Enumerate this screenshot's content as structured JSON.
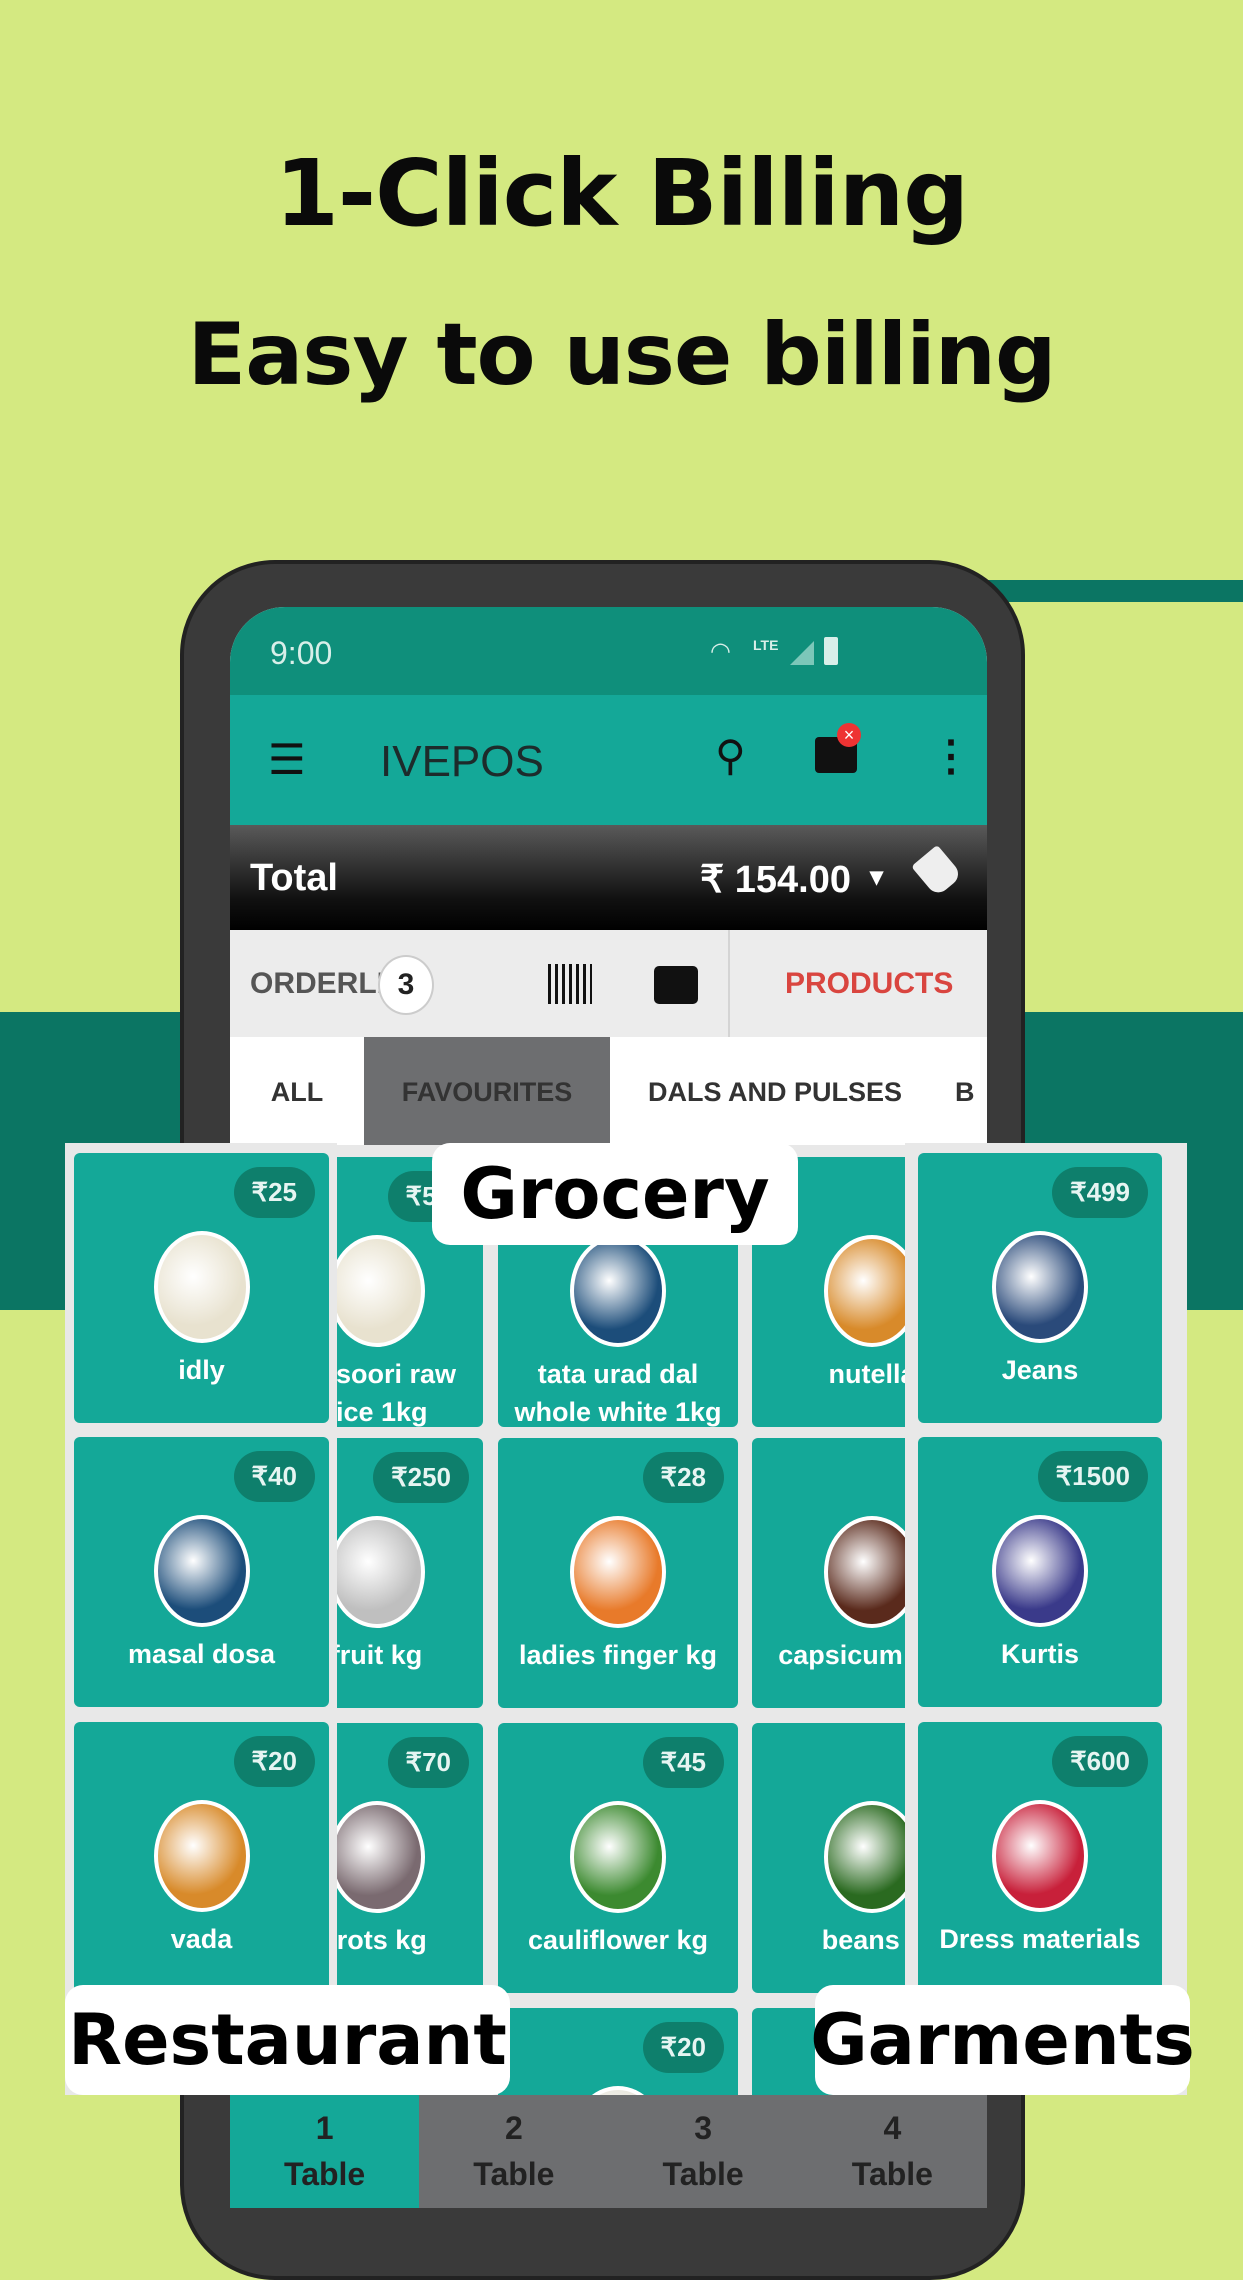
{
  "headline": "1-Click Billing",
  "subheadline": "Easy to use billing",
  "status": {
    "time": "9:00",
    "network": "LTE"
  },
  "appbar": {
    "title": "IVEPOS"
  },
  "total": {
    "label": "Total",
    "amount": "₹ 154.00"
  },
  "orderbar": {
    "orderlist": "ORDERLIST",
    "count": "3",
    "products": "PRODUCTS"
  },
  "categories": [
    {
      "label": "ALL"
    },
    {
      "label": "FAVOURITES"
    },
    {
      "label": "DALS AND PULSES"
    },
    {
      "label": "B"
    }
  ],
  "restaurant": {
    "label": "Restaurant",
    "items": [
      {
        "name": "idly",
        "price": "₹25"
      },
      {
        "name": "masal dosa",
        "price": "₹40"
      },
      {
        "name": "vada",
        "price": "₹20"
      }
    ]
  },
  "grocery": {
    "label": "Grocery",
    "items": [
      {
        "name": "masoori raw rice 1kg",
        "price": "₹56"
      },
      {
        "name": "tata urad dal whole white 1kg",
        "price": ""
      },
      {
        "name": "nutella",
        "price": "₹"
      },
      {
        "name": "fruit kg",
        "price": "₹250"
      },
      {
        "name": "ladies finger kg",
        "price": "₹28"
      },
      {
        "name": "capsicum g kg",
        "price": "₹"
      },
      {
        "name": "rrots kg",
        "price": "₹70"
      },
      {
        "name": "cauliflower kg",
        "price": "₹45"
      },
      {
        "name": "beans k",
        "price": "₹"
      },
      {
        "name": "",
        "price": ""
      },
      {
        "name": "",
        "price": "₹20"
      },
      {
        "name": "",
        "price": ""
      }
    ]
  },
  "garments": {
    "label": "Garments",
    "items": [
      {
        "name": "Jeans",
        "price": "₹499"
      },
      {
        "name": "Kurtis",
        "price": "₹1500"
      },
      {
        "name": "Dress materials",
        "price": "₹600"
      }
    ]
  },
  "tables": [
    {
      "num": "1",
      "label": "Table"
    },
    {
      "num": "2",
      "label": "Table"
    },
    {
      "num": "3",
      "label": "Table"
    },
    {
      "num": "4",
      "label": "Table"
    }
  ],
  "colors": {
    "background": "#d4e981",
    "band": "#0b7563",
    "teal": "#14a898",
    "products": "#d9453f"
  }
}
